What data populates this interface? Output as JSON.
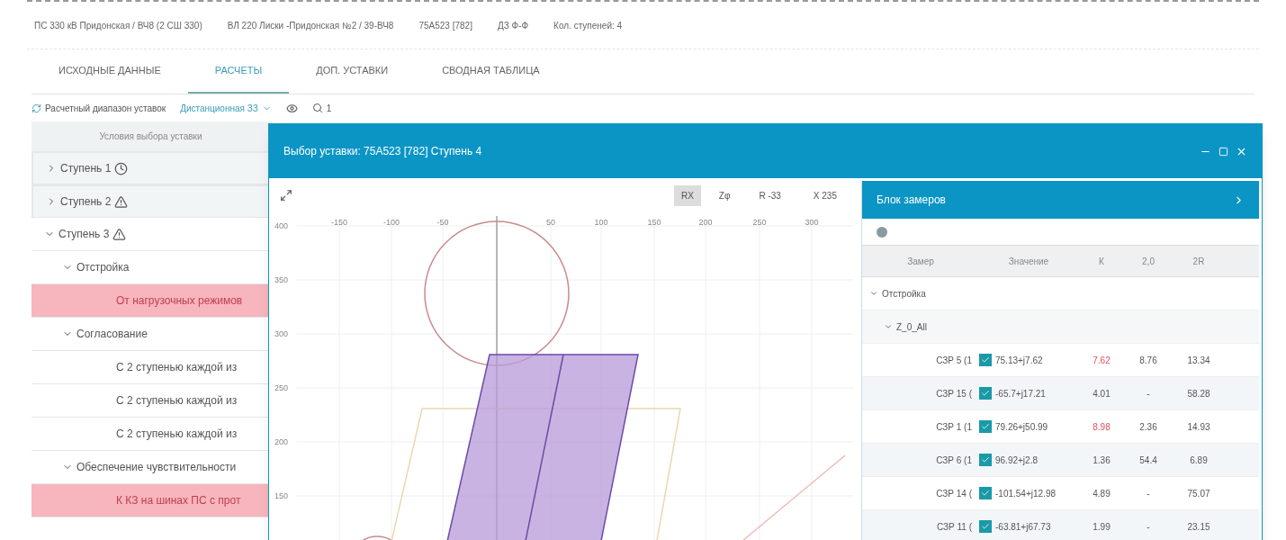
{
  "breadcrumb": [
    "ПС 330 кВ Придонская / ВЧ8 (2 СШ 330)",
    "ВЛ 220 Лиски -Придонская №2 / 39-ВЧ8",
    "75А523 [782]",
    "ДЗ Ф-Ф",
    "Кол. ступеней: 4"
  ],
  "tabs": [
    {
      "label": "ИСХОДНЫЕ ДАННЫЕ",
      "selected": false
    },
    {
      "label": "РАСЧЕТЫ",
      "selected": true
    },
    {
      "label": "ДОП. УСТАВКИ",
      "selected": false
    },
    {
      "label": "СВОДНАЯ ТАБЛИЦА",
      "selected": false
    }
  ],
  "toolbar": {
    "range_button": "Расчетный диапазон уставок",
    "dropdown": "Дистанционная ЗЗ",
    "search_count": "1"
  },
  "conditions": {
    "header": "Условия выбора уставки",
    "items": [
      {
        "label": "Ступень 1",
        "kind": "pending",
        "expanded": false,
        "error": false
      },
      {
        "label": "Ступень 2",
        "kind": "warning",
        "expanded": false,
        "error": false
      },
      {
        "label": "Ступень 3",
        "kind": "warning",
        "expanded": true,
        "error": false,
        "children": [
          {
            "label": "Отстройка",
            "expanded": true,
            "error": false,
            "children": [
              {
                "label": "От нагрузочных режимов",
                "error": true
              }
            ]
          },
          {
            "label": "Согласование",
            "expanded": true,
            "error": false,
            "children": [
              {
                "label": "С 2 ступенью каждой из",
                "error": false
              },
              {
                "label": "С 2 ступенью каждой из",
                "error": false
              },
              {
                "label": "С 2 ступенью каждой из",
                "error": false
              }
            ]
          },
          {
            "label": "Обеспечение чувствительности",
            "expanded": true,
            "error": false,
            "children": [
              {
                "label": "К КЗ на шинах ПС с прот",
                "error": true
              }
            ]
          }
        ]
      }
    ]
  },
  "dialog": {
    "title": "Выбор уставки: 75А523 [782] Ступень 4",
    "modes": [
      {
        "label": "RX",
        "selected": true
      },
      {
        "label": "Zφ",
        "selected": false
      }
    ],
    "readouts": [
      "R -33",
      "X 235"
    ],
    "chart": {
      "x_ticks": [
        "-150",
        "-100",
        "-50",
        "50",
        "100",
        "150",
        "200",
        "250",
        "300"
      ],
      "y_ticks": [
        "400",
        "350",
        "300",
        "250",
        "200",
        "150"
      ]
    },
    "measurements": {
      "title": "Блок замеров",
      "columns": [
        "Замер",
        "Значение",
        "К",
        "2,0",
        "2R"
      ],
      "group": "Отстройка",
      "subgroup": "Z_0_All",
      "rows": [
        {
          "name": "СЗР 5 (1",
          "checked": true,
          "value": "75.13+j7.62",
          "k": "7.62",
          "k_alert": true,
          "c4": "8.76",
          "c5": "13.34"
        },
        {
          "name": "СЗР 15 (",
          "checked": true,
          "value": "-65.7+j17.21",
          "k": "4.01",
          "k_alert": false,
          "c4": "-",
          "c5": "58.28"
        },
        {
          "name": "СЗР 1 (1",
          "checked": true,
          "value": "79.26+j50.99",
          "k": "8.98",
          "k_alert": true,
          "c4": "2.36",
          "c5": "14.93"
        },
        {
          "name": "СЗР 6 (1",
          "checked": true,
          "value": "96.92+j2.8",
          "k": "1.36",
          "k_alert": false,
          "c4": "54.4",
          "c5": "6.89"
        },
        {
          "name": "СЗР 14 (",
          "checked": true,
          "value": "-101.54+j12.98",
          "k": "4.89",
          "k_alert": false,
          "c4": "-",
          "c5": "75.07"
        },
        {
          "name": "СЗР 11 (",
          "checked": true,
          "value": "-63.81+j67.73",
          "k": "1.99",
          "k_alert": false,
          "c4": "-",
          "c5": "23.15"
        }
      ]
    }
  }
}
